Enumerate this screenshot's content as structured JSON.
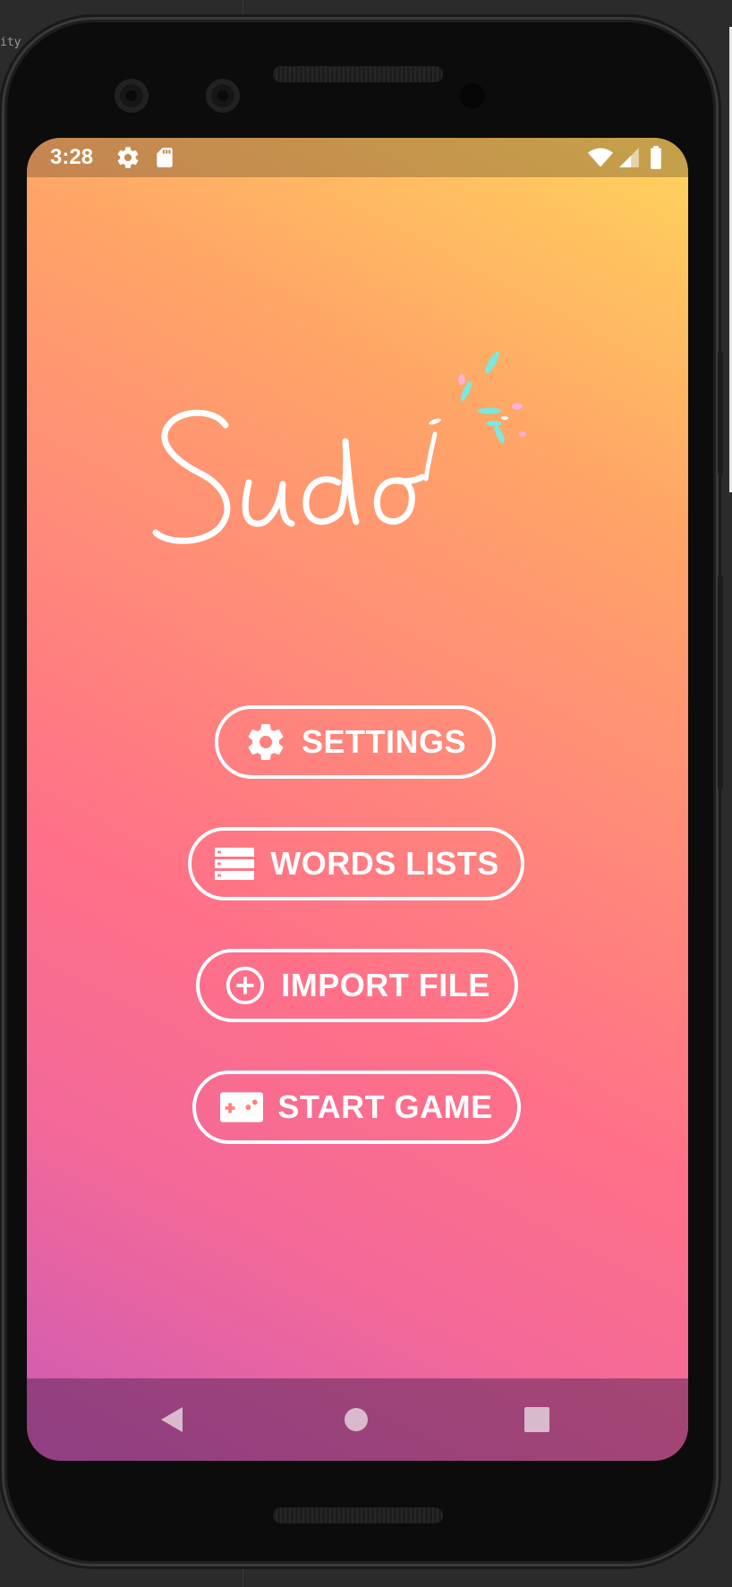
{
  "ide": {
    "fragment_text": "ity"
  },
  "status_bar": {
    "time": "3:28",
    "icons": [
      "gear-icon",
      "sd-card-icon",
      "wifi-icon",
      "signal-icon",
      "battery-icon"
    ]
  },
  "app": {
    "logo_text": "Sudo",
    "accent_colors": [
      "#ffd45c",
      "#ff8c78",
      "#ff7088",
      "#cc5ab5"
    ],
    "menu": [
      {
        "label": "SETTINGS",
        "icon": "gear-icon"
      },
      {
        "label": "WORDS LISTS",
        "icon": "list-icon"
      },
      {
        "label": "IMPORT FILE",
        "icon": "add-circle-icon"
      },
      {
        "label": "START GAME",
        "icon": "gamepad-icon"
      }
    ]
  },
  "nav_bar": {
    "buttons": [
      "back-icon",
      "home-icon",
      "recents-icon"
    ]
  }
}
